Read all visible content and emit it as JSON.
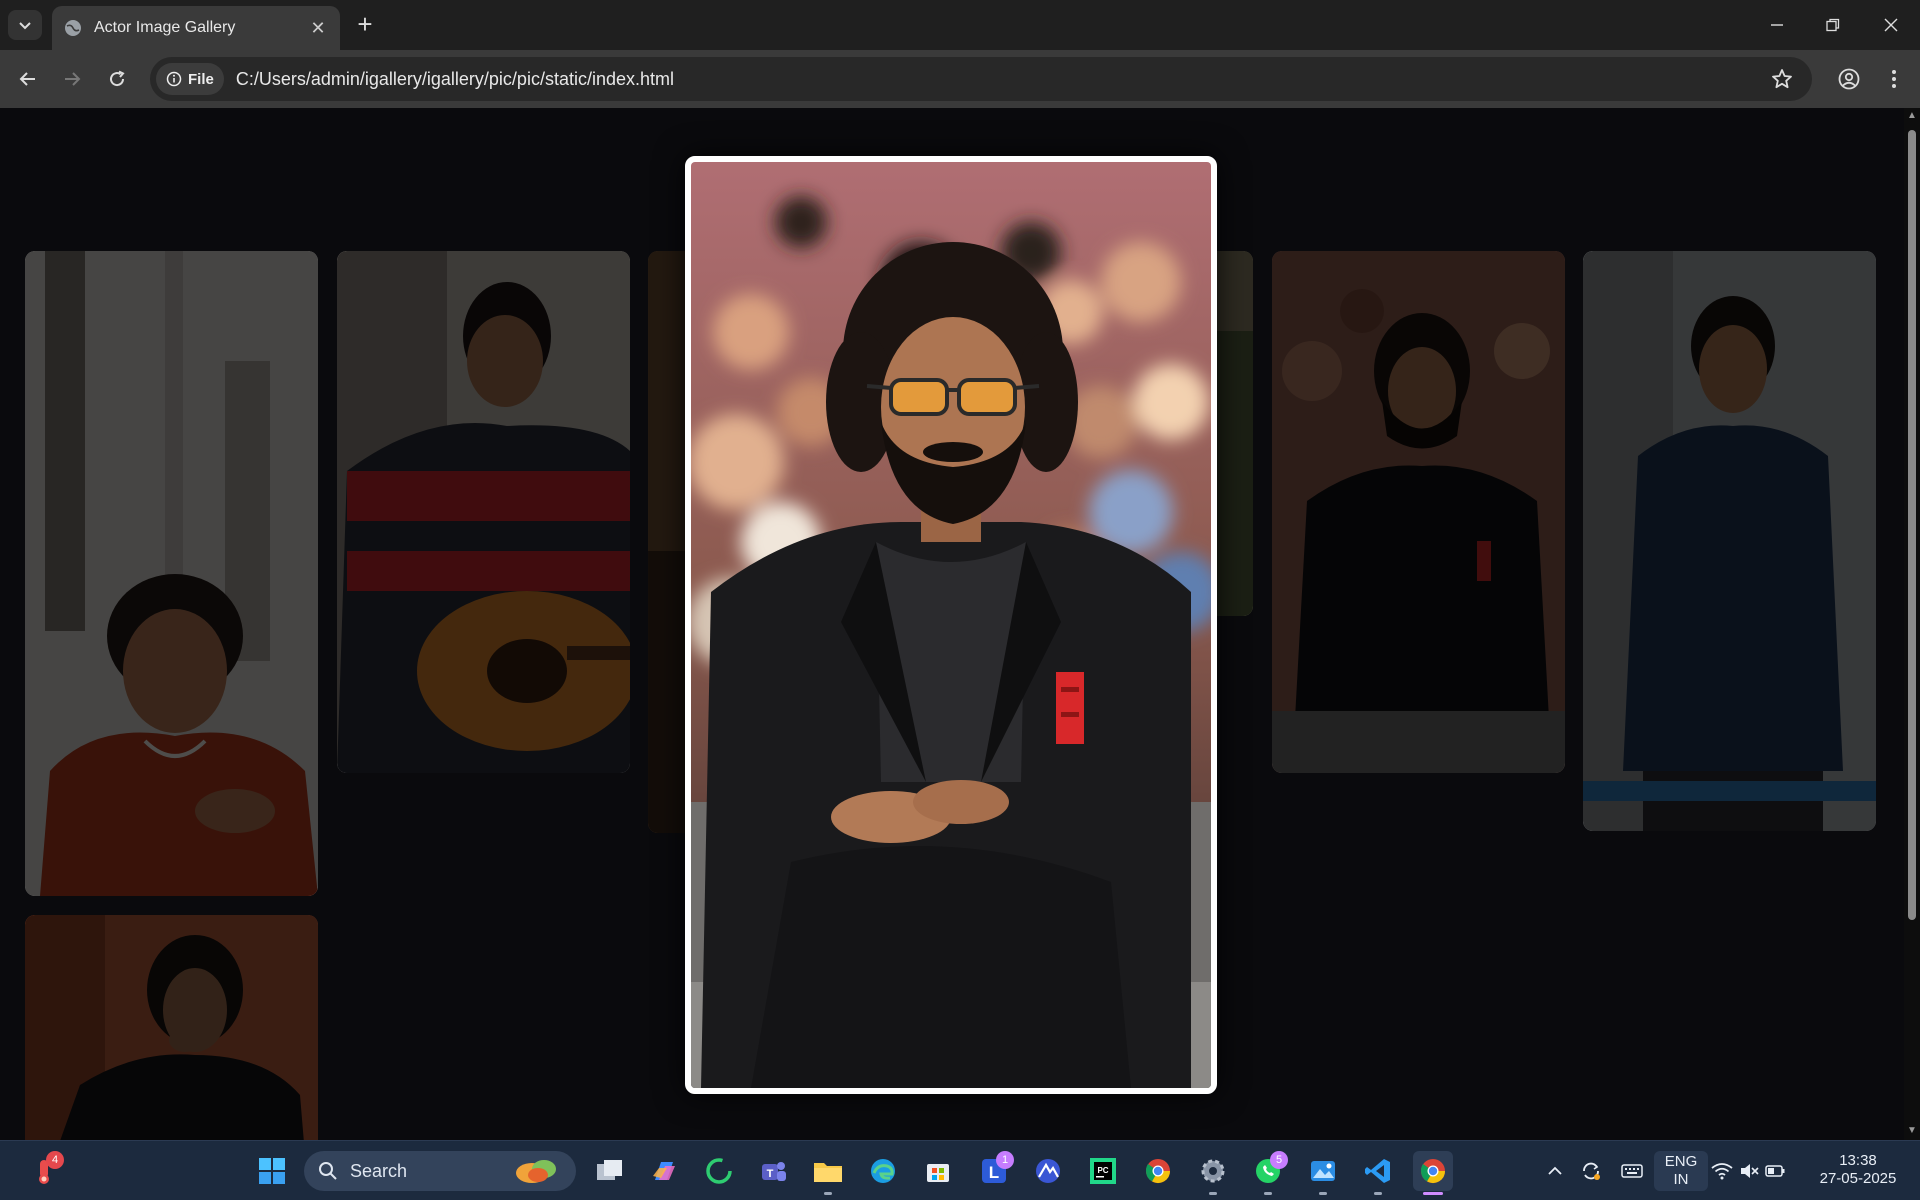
{
  "browser": {
    "tab_title": "Actor Image Gallery",
    "address_chip": "File",
    "url": "C:/Users/admin/igallery/igallery/pic/pic/static/index.html"
  },
  "gallery": {
    "cards": [
      {
        "name": "gallery-card-1"
      },
      {
        "name": "gallery-card-2"
      },
      {
        "name": "gallery-card-3"
      },
      {
        "name": "gallery-card-4"
      },
      {
        "name": "gallery-card-5"
      },
      {
        "name": "gallery-card-6"
      },
      {
        "name": "gallery-card-7"
      }
    ],
    "modal_open": true
  },
  "taskbar": {
    "search_placeholder": "Search",
    "notification_badge": "4",
    "lens_badge": "1",
    "whatsapp_badge": "5",
    "language_line1": "ENG",
    "language_line2": "IN",
    "time": "13:38",
    "date": "27-05-2025"
  },
  "colors": {
    "tabstrip": "#1f1f1f",
    "toolbar": "#3a3a3a",
    "page_background": "#0a0a0d",
    "taskbar": "#1c2a3e",
    "modal_border": "#ffffff"
  }
}
